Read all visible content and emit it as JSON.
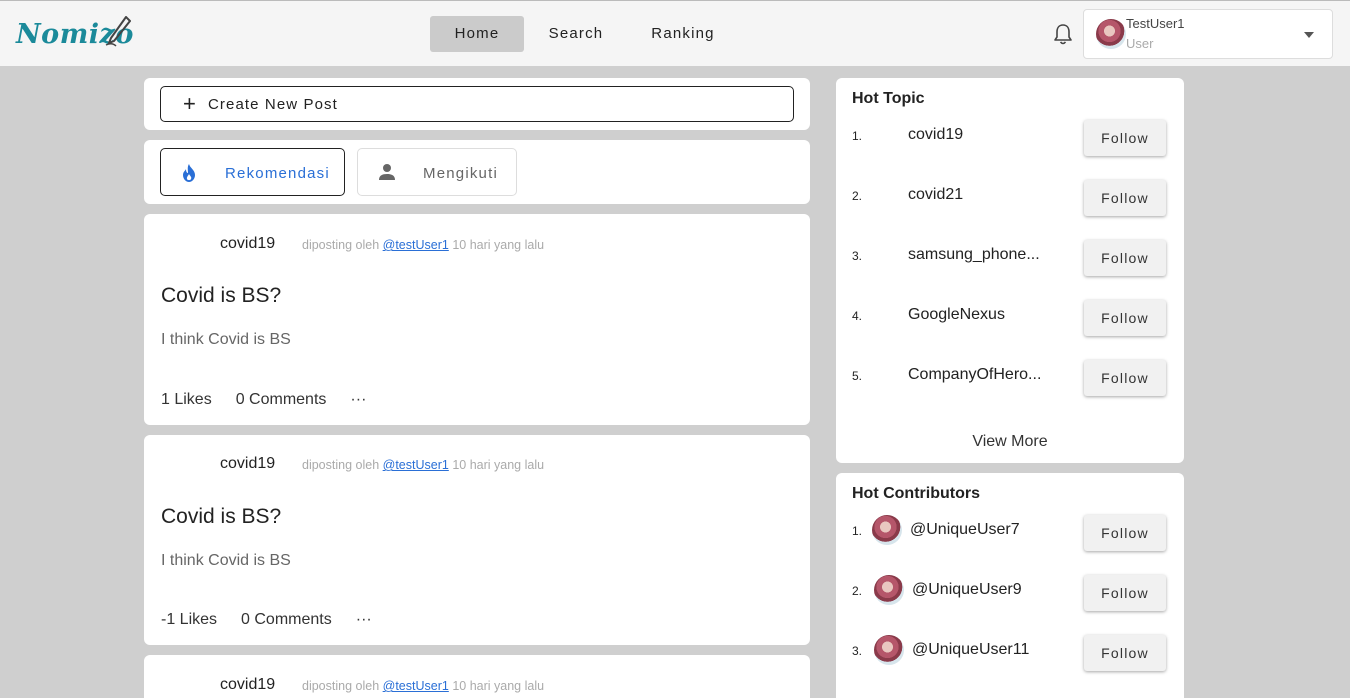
{
  "app": {
    "logo_text": "Nomizo"
  },
  "nav": {
    "items": [
      {
        "label": "Home",
        "active": true
      },
      {
        "label": "Search",
        "active": false
      },
      {
        "label": "Ranking",
        "active": false
      }
    ]
  },
  "user": {
    "name": "TestUser1",
    "role": "User"
  },
  "composer": {
    "create_label": "Create New Post"
  },
  "feed_tabs": [
    {
      "label": "Rekomendasi",
      "icon": "fire-icon",
      "active": true,
      "color": "#2a6fd6"
    },
    {
      "label": "Mengikuti",
      "icon": "person-icon",
      "active": false,
      "color": "#666666"
    }
  ],
  "posts": [
    {
      "topic": "covid19",
      "meta_prefix": "diposting oleh",
      "author": "@testUser1",
      "time": "10 hari yang lalu",
      "title": "Covid is BS?",
      "body": "I think Covid is BS",
      "likes": "1 Likes",
      "comments": "0 Comments",
      "more": "···"
    },
    {
      "topic": "covid19",
      "meta_prefix": "diposting oleh",
      "author": "@testUser1",
      "time": "10 hari yang lalu",
      "title": "Covid is BS?",
      "body": "I think Covid is BS",
      "likes": "-1 Likes",
      "comments": "0 Comments",
      "more": "···"
    },
    {
      "topic": "covid19",
      "meta_prefix": "diposting oleh",
      "author": "@testUser1",
      "time": "10 hari yang lalu"
    }
  ],
  "hot_topic": {
    "title": "Hot Topic",
    "items": [
      {
        "rank": "1.",
        "name": "covid19",
        "action": "Follow"
      },
      {
        "rank": "2.",
        "name": "covid21",
        "action": "Follow"
      },
      {
        "rank": "3.",
        "name": "samsung_phone...",
        "action": "Follow"
      },
      {
        "rank": "4.",
        "name": "GoogleNexus",
        "action": "Follow"
      },
      {
        "rank": "5.",
        "name": "CompanyOfHero...",
        "action": "Follow"
      }
    ],
    "view_more": "View More"
  },
  "hot_contributors": {
    "title": "Hot Contributors",
    "items": [
      {
        "rank": "1.",
        "name": "@UniqueUser7",
        "action": "Follow"
      },
      {
        "rank": "2.",
        "name": "@UniqueUser9",
        "action": "Follow"
      },
      {
        "rank": "3.",
        "name": "@UniqueUser11",
        "action": "Follow"
      }
    ]
  },
  "colors": {
    "brand": "#1b8a9a",
    "link": "#2a6fd6",
    "page_bg": "#cfcfcf",
    "topbar_bg": "#f5f5f5"
  }
}
